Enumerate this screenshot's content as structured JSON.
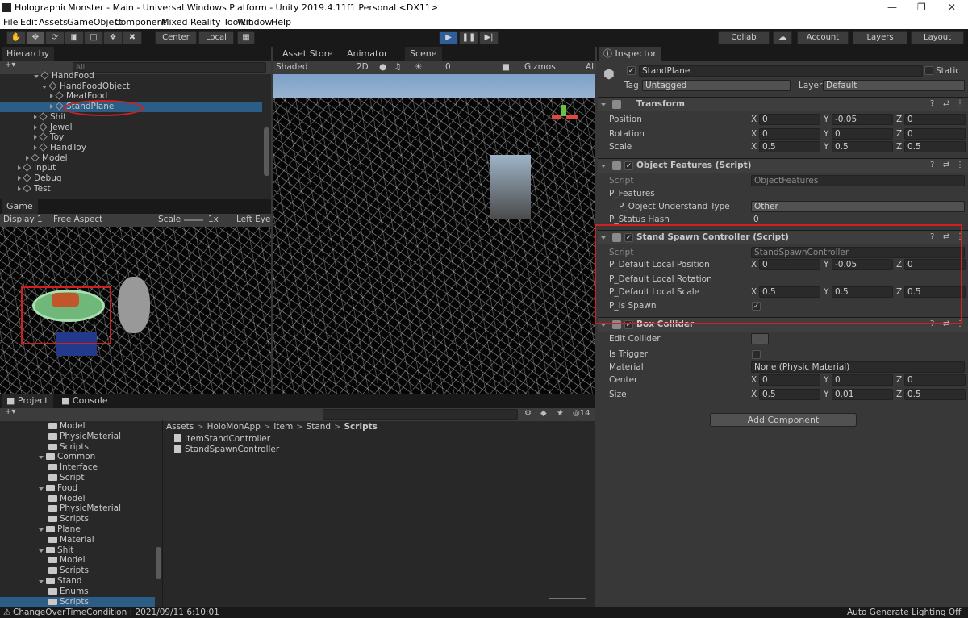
{
  "window": {
    "title": "HolographicMonster - Main - Universal Windows Platform - Unity 2019.4.11f1 Personal <DX11>"
  },
  "menu": [
    "File",
    "Edit",
    "Assets",
    "GameObject",
    "Component",
    "Mixed Reality Toolkit",
    "Window",
    "Help"
  ],
  "toolbar": {
    "center": "Center",
    "local": "Local",
    "collab": "Collab",
    "account": "Account",
    "layers": "Layers",
    "layout": "Layout"
  },
  "hierarchy": {
    "tab": "Hierarchy",
    "search_placeholder": "All",
    "items": [
      {
        "label": "HandFood",
        "indent": 4,
        "kind": "obj",
        "open": true
      },
      {
        "label": "HandFoodObject",
        "indent": 5,
        "kind": "obj",
        "open": true
      },
      {
        "label": "MeatFood",
        "indent": 6,
        "kind": "obj"
      },
      {
        "label": "StandPlane",
        "indent": 6,
        "kind": "obj",
        "selected": true
      },
      {
        "label": "Shit",
        "indent": 4,
        "kind": "obj"
      },
      {
        "label": "Jewel",
        "indent": 4,
        "kind": "obj"
      },
      {
        "label": "Toy",
        "indent": 4,
        "kind": "obj"
      },
      {
        "label": "HandToy",
        "indent": 4,
        "kind": "obj"
      },
      {
        "label": "Model",
        "indent": 3,
        "kind": "obj"
      },
      {
        "label": "Input",
        "indent": 2,
        "kind": "obj"
      },
      {
        "label": "Debug",
        "indent": 2,
        "kind": "obj"
      },
      {
        "label": "Test",
        "indent": 2,
        "kind": "obj"
      }
    ]
  },
  "game": {
    "tab": "Game",
    "display": "Display 1",
    "aspect": "Free Aspect",
    "scale_label": "Scale",
    "scale_value": "1x",
    "eye": "Left Eye"
  },
  "scene": {
    "tabs": [
      "Asset Store",
      "Animator",
      "Scene"
    ],
    "shading": "Shaded",
    "mode2d": "2D",
    "fx": "0",
    "gizmos": "Gizmos",
    "search_placeholder": "All"
  },
  "project": {
    "tabs": [
      "Project",
      "Console"
    ],
    "count": "14",
    "tree": [
      {
        "label": "Model",
        "indent": 4
      },
      {
        "label": "PhysicMaterial",
        "indent": 4
      },
      {
        "label": "Scripts",
        "indent": 4
      },
      {
        "label": "Common",
        "indent": 3,
        "open": true
      },
      {
        "label": "Interface",
        "indent": 4
      },
      {
        "label": "Script",
        "indent": 4
      },
      {
        "label": "Food",
        "indent": 3,
        "open": true
      },
      {
        "label": "Model",
        "indent": 4
      },
      {
        "label": "PhysicMaterial",
        "indent": 4
      },
      {
        "label": "Scripts",
        "indent": 4
      },
      {
        "label": "Plane",
        "indent": 3,
        "open": true
      },
      {
        "label": "Material",
        "indent": 4
      },
      {
        "label": "Shit",
        "indent": 3,
        "open": true
      },
      {
        "label": "Model",
        "indent": 4
      },
      {
        "label": "Scripts",
        "indent": 4
      },
      {
        "label": "Stand",
        "indent": 3,
        "open": true
      },
      {
        "label": "Enums",
        "indent": 4
      },
      {
        "label": "Scripts",
        "indent": 4,
        "selected": true
      }
    ],
    "breadcrumb": [
      "Assets",
      "HoloMonApp",
      "Item",
      "Stand",
      "Scripts"
    ],
    "files": [
      "ItemStandController",
      "StandSpawnController"
    ]
  },
  "inspector": {
    "tab": "Inspector",
    "name": "StandPlane",
    "static_label": "Static",
    "tag_label": "Tag",
    "tag_value": "Untagged",
    "layer_label": "Layer",
    "layer_value": "Default",
    "transform": {
      "title": "Transform",
      "position": {
        "label": "Position",
        "x": "0",
        "y": "-0.05",
        "z": "0"
      },
      "rotation": {
        "label": "Rotation",
        "x": "0",
        "y": "0",
        "z": "0"
      },
      "scale": {
        "label": "Scale",
        "x": "0.5",
        "y": "0.5",
        "z": "0.5"
      }
    },
    "object_features": {
      "title": "Object Features (Script)",
      "script_label": "Script",
      "script_value": "ObjectFeatures",
      "features_label": "P_Features",
      "understand_label": "P_Object Understand Type",
      "understand_value": "Other",
      "hash_label": "P_Status Hash",
      "hash_value": "0"
    },
    "stand_spawn": {
      "title": "Stand Spawn Controller (Script)",
      "script_label": "Script",
      "script_value": "StandSpawnController",
      "pos": {
        "label": "P_Default Local Position",
        "x": "0",
        "y": "-0.05",
        "z": "0"
      },
      "rot_label": "P_Default Local Rotation",
      "scale": {
        "label": "P_Default Local Scale",
        "x": "0.5",
        "y": "0.5",
        "z": "0.5"
      },
      "spawn_label": "P_Is Spawn"
    },
    "box_collider": {
      "title": "Box Collider",
      "edit_label": "Edit Collider",
      "trigger_label": "Is Trigger",
      "material_label": "Material",
      "material_value": "None (Physic Material)",
      "center": {
        "label": "Center",
        "x": "0",
        "y": "0",
        "z": "0"
      },
      "size": {
        "label": "Size",
        "x": "0.5",
        "y": "0.01",
        "z": "0.5"
      }
    },
    "add_component": "Add Component"
  },
  "axis": {
    "x": "X",
    "y": "Y",
    "z": "Z"
  },
  "status": {
    "left": "ChangeOverTimeCondition : 2021/09/11 6:10:01",
    "right": "Auto Generate Lighting Off"
  }
}
